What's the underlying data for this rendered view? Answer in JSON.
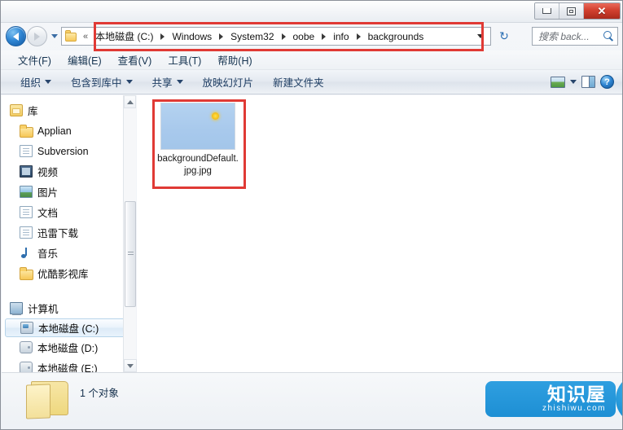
{
  "window": {
    "controls": {
      "minimize": "–",
      "maximize": "□",
      "close": "✕"
    }
  },
  "address": {
    "back_icon": "back-arrow-icon",
    "forward_icon": "forward-arrow-icon",
    "history_icon": "history-dropdown-icon",
    "folder_icon": "folder-icon",
    "overflow": "«",
    "crumbs": [
      "本地磁盘 (C:)",
      "Windows",
      "System32",
      "oobe",
      "info",
      "backgrounds"
    ],
    "dropdown_icon": "chevron-down-icon",
    "refresh_icon": "↻",
    "search_placeholder": "搜索 back...",
    "search_value": "",
    "search_icon": "magnifier-icon"
  },
  "menu": {
    "items": [
      "文件(F)",
      "编辑(E)",
      "查看(V)",
      "工具(T)",
      "帮助(H)"
    ]
  },
  "toolbar": {
    "items": [
      {
        "label": "组织",
        "has_caret": true
      },
      {
        "label": "包含到库中",
        "has_caret": true
      },
      {
        "label": "共享",
        "has_caret": true
      },
      {
        "label": "放映幻灯片",
        "has_caret": false
      },
      {
        "label": "新建文件夹",
        "has_caret": false
      }
    ],
    "view_icon": "view-mode-icon",
    "view_caret_icon": "chevron-down-icon",
    "pane_icon": "preview-pane-icon",
    "help_icon": "help-icon",
    "help_glyph": "?"
  },
  "sidebar": {
    "groups": [
      {
        "root": {
          "label": "库",
          "icon": "library-icon"
        },
        "items": [
          {
            "label": "Applian",
            "icon": "folder-icon"
          },
          {
            "label": "Subversion",
            "icon": "document-icon"
          },
          {
            "label": "视频",
            "icon": "video-icon"
          },
          {
            "label": "图片",
            "icon": "pictures-icon"
          },
          {
            "label": "文档",
            "icon": "documents-icon"
          },
          {
            "label": "迅雷下载",
            "icon": "download-icon"
          },
          {
            "label": "音乐",
            "icon": "music-icon"
          },
          {
            "label": "优酷影视库",
            "icon": "folder-icon"
          }
        ]
      },
      {
        "root": {
          "label": "计算机",
          "icon": "computer-icon"
        },
        "items": [
          {
            "label": "本地磁盘 (C:)",
            "icon": "hard-drive-icon",
            "selected": true
          },
          {
            "label": "本地磁盘 (D:)",
            "icon": "hard-drive-icon",
            "selected": false
          },
          {
            "label": "本地磁盘 (E:)",
            "icon": "hard-drive-icon",
            "selected": false
          }
        ]
      }
    ],
    "scroll_up_icon": "scroll-up-arrow-icon",
    "scroll_down_icon": "scroll-down-arrow-icon"
  },
  "content": {
    "files": [
      {
        "name": "backgroundDefault.jpg.jpg",
        "thumb": "blue-sky-image",
        "accent": "#a8c9ec"
      }
    ]
  },
  "status": {
    "folder_icon": "open-folder-icon",
    "object_count": "1 个对象"
  },
  "watermark": {
    "brand": "知识屋",
    "url": "zhishiwu.com",
    "icon": "monitor-question-icon",
    "question": "?",
    "color": "#1d8fd4"
  },
  "annotations": {
    "color": "#e03a35",
    "boxes": [
      "address-bar-highlight",
      "file-item-highlight"
    ]
  }
}
